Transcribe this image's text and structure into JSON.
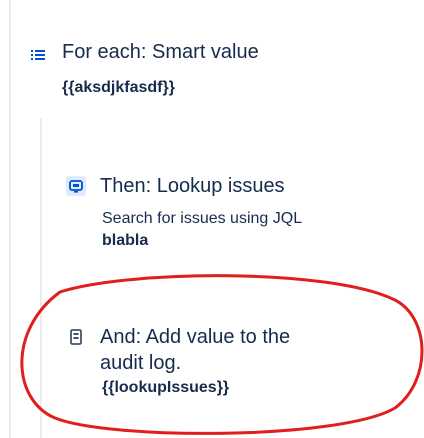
{
  "steps": [
    {
      "icon": "list-icon",
      "title": "For each: Smart value",
      "value": "{{aksdjkfasdf}}"
    },
    {
      "icon": "search-issue-icon",
      "title": "Then: Lookup issues",
      "description": "Search for issues using JQL",
      "value": "blabla"
    },
    {
      "icon": "audit-log-icon",
      "title_line1": "And: Add value to the",
      "title_line2": "audit log.",
      "value": "{{lookupIssues}}"
    }
  ],
  "colors": {
    "text": "#172b4d",
    "icon_bg": "#deebff",
    "icon_fg": "#0052cc",
    "rail": "#ebecf0",
    "annotation": "#e01e1e"
  }
}
